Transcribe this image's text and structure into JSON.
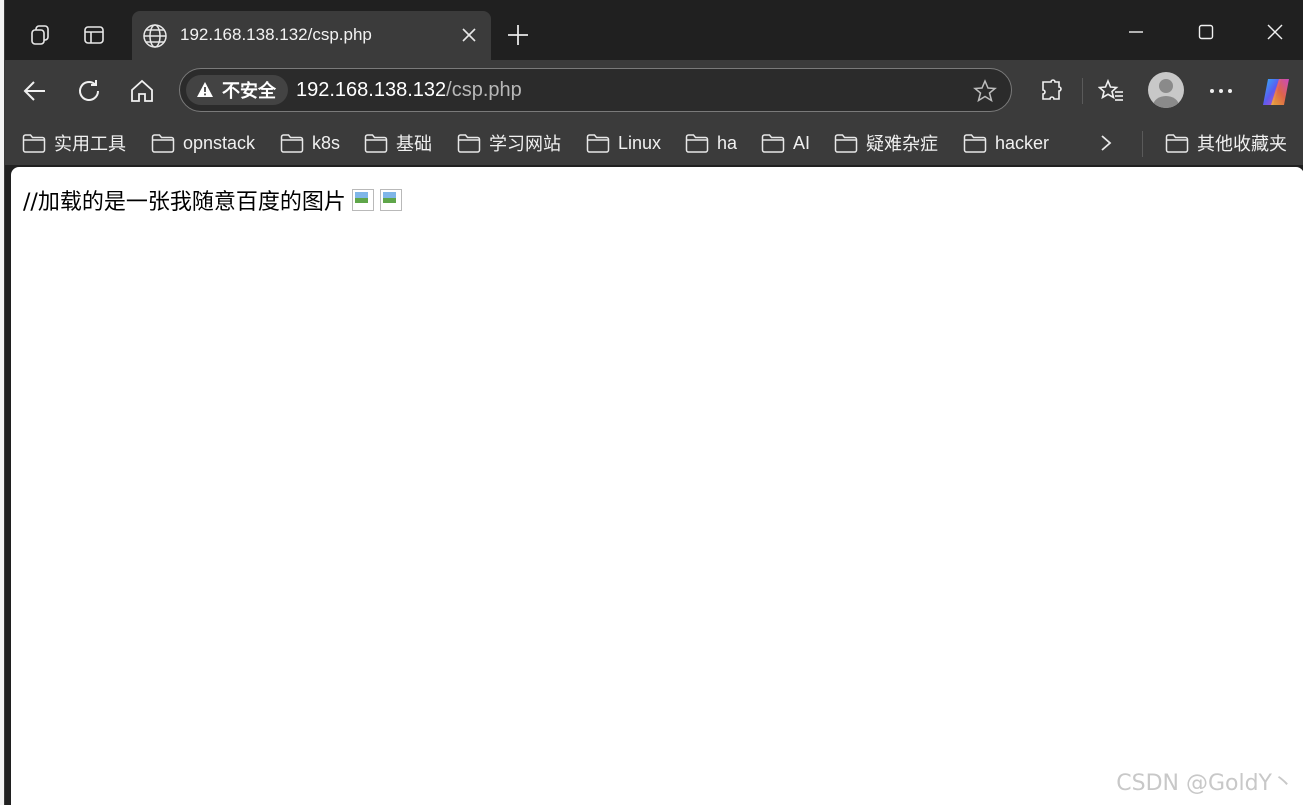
{
  "tab": {
    "title": "192.168.138.132/csp.php"
  },
  "address_bar": {
    "security_label": "不安全",
    "url_host": "192.168.138.132",
    "url_path": "/csp.php"
  },
  "bookmarks": {
    "items": [
      "实用工具",
      "opnstack",
      "k8s",
      "基础",
      "学习网站",
      "Linux",
      "ha",
      "AI",
      "疑难杂症",
      "hacker"
    ],
    "other": "其他收藏夹"
  },
  "page": {
    "text": "//加载的是一张我随意百度的图片",
    "broken_images": 2
  },
  "watermark": "CSDN @GoldY丶"
}
